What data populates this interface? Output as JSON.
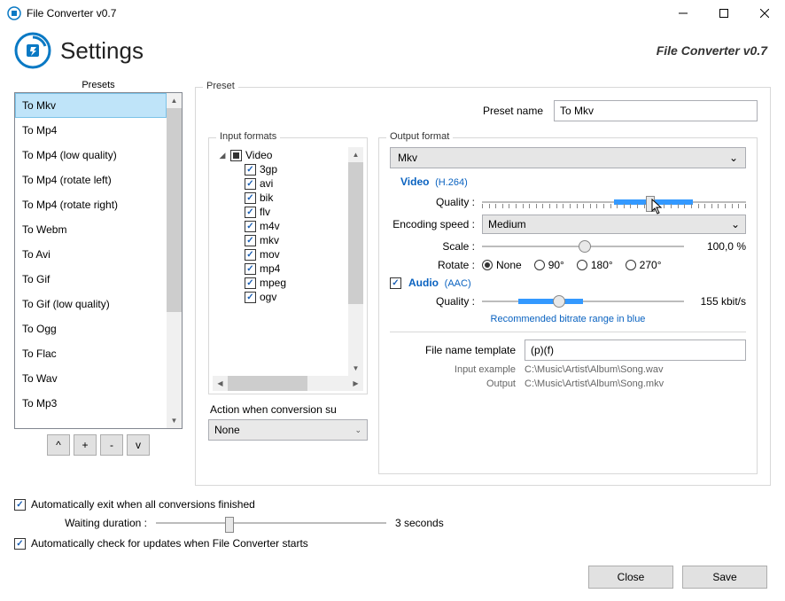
{
  "titlebar": {
    "title": "File Converter v0.7"
  },
  "header": {
    "title": "Settings",
    "brand": "File Converter v0.7"
  },
  "presets": {
    "label": "Presets",
    "items": [
      "To Mkv",
      "To Mp4",
      "To Mp4 (low quality)",
      "To Mp4 (rotate left)",
      "To Mp4 (rotate right)",
      "To Webm",
      "To Avi",
      "To Gif",
      "To Gif (low quality)",
      "To Ogg",
      "To Flac",
      "To Wav",
      "To Mp3"
    ],
    "selected": 0,
    "btn_up": "^",
    "btn_add": "+",
    "btn_remove": "-",
    "btn_down": "v"
  },
  "preset_panel": {
    "label": "Preset",
    "name_label": "Preset name",
    "name_value": "To Mkv"
  },
  "input_formats": {
    "label": "Input formats",
    "root": "Video",
    "items": [
      "3gp",
      "avi",
      "bik",
      "flv",
      "m4v",
      "mkv",
      "mov",
      "mp4",
      "mpeg",
      "ogv"
    ]
  },
  "action": {
    "label": "Action when conversion su",
    "value": "None"
  },
  "output": {
    "label": "Output format",
    "value": "Mkv",
    "video": {
      "title": "Video",
      "codec": "(H.264)",
      "quality_label": "Quality :",
      "enc_label": "Encoding speed :",
      "enc_value": "Medium",
      "scale_label": "Scale :",
      "scale_value": "100,0 %",
      "rotate_label": "Rotate :",
      "rotate_options": [
        "None",
        "90°",
        "180°",
        "270°"
      ],
      "rotate_selected": 0
    },
    "audio": {
      "title": "Audio",
      "codec": "(AAC)",
      "enabled": true,
      "quality_label": "Quality :",
      "quality_value": "155 kbit/s",
      "hint": "Recommended bitrate range in blue"
    },
    "fnt": {
      "label": "File name template",
      "value": "(p)(f)",
      "in_label": "Input example",
      "in_value": "C:\\Music\\Artist\\Album\\Song.wav",
      "out_label": "Output",
      "out_value": "C:\\Music\\Artist\\Album\\Song.mkv"
    }
  },
  "bottom": {
    "auto_exit": "Automatically exit when all conversions finished",
    "wait_label": "Waiting duration :",
    "wait_value": "3 seconds",
    "auto_update": "Automatically check for updates when File Converter starts"
  },
  "footer": {
    "close": "Close",
    "save": "Save"
  }
}
